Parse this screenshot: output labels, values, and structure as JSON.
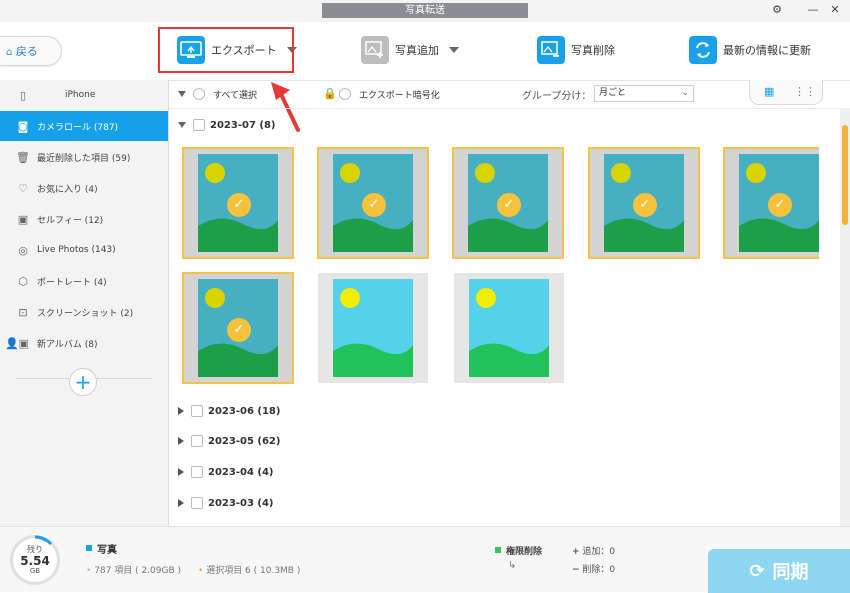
{
  "window": {
    "title": "写真転送"
  },
  "toolbar": {
    "back_label": "戻る",
    "export_label": "エクスポート",
    "add_label": "写真追加",
    "delete_label": "写真削除",
    "refresh_label": "最新の情報に更新"
  },
  "sidebar": {
    "device": "iPhone",
    "items": [
      {
        "label": "カメラロール (787)",
        "icon": "camera-icon",
        "active": true
      },
      {
        "label": "最近削除した項目 (59)",
        "icon": "trash-icon"
      },
      {
        "label": "お気に入り (4)",
        "icon": "heart-icon"
      },
      {
        "label": "セルフィー (12)",
        "icon": "portrait-icon"
      },
      {
        "label": "Live Photos (143)",
        "icon": "live-photo-icon"
      },
      {
        "label": "ポートレート (4)",
        "icon": "cube-icon"
      },
      {
        "label": "スクリーンショット (2)",
        "icon": "screenshot-icon"
      },
      {
        "label": "新アルバム (8)",
        "icon": "album-icon"
      }
    ]
  },
  "filter": {
    "select_all": "すべて選択",
    "encrypt": "エクスポート暗号化",
    "group_label": "グループ分け：",
    "group_value": "月ごと"
  },
  "groups": [
    {
      "label": "2023-07 (8)",
      "expanded": true
    },
    {
      "label": "2023-06 (18)"
    },
    {
      "label": "2023-05 (62)"
    },
    {
      "label": "2023-04 (4)"
    },
    {
      "label": "2023-03 (4)"
    }
  ],
  "status": {
    "storage_label": "残り",
    "storage_value": "5.54",
    "storage_unit": "GB",
    "category": "写真",
    "total": "787 項目 ( 2.09GB )",
    "selected": "選択項目 6 ( 10.3MB )",
    "perm_delete": "権限削除",
    "add": "追加：0",
    "remove": "削除：0",
    "sync": "同期"
  },
  "colors": {
    "accent": "#16a0e8",
    "selection": "#f2c347",
    "highlight": "#e53935"
  }
}
